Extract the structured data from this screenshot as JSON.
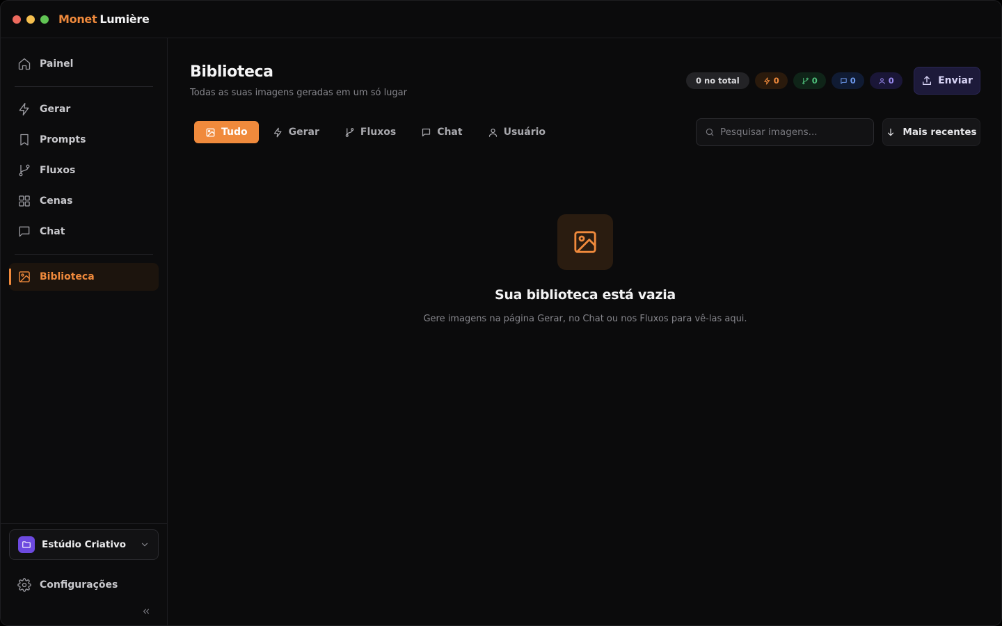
{
  "app": {
    "brand_part1": "Monet",
    "brand_part2": "Lumière",
    "accent_color": "#f08a3c"
  },
  "sidebar": {
    "items": [
      {
        "label": "Painel",
        "icon": "home-icon"
      },
      {
        "label": "Gerar",
        "icon": "bolt-icon"
      },
      {
        "label": "Prompts",
        "icon": "bookmark-icon"
      },
      {
        "label": "Fluxos",
        "icon": "git-branch-icon"
      },
      {
        "label": "Cenas",
        "icon": "grid-icon"
      },
      {
        "label": "Chat",
        "icon": "chat-icon"
      },
      {
        "label": "Biblioteca",
        "icon": "image-icon",
        "active": true
      }
    ],
    "workspace": {
      "label": "Estúdio Criativo",
      "icon": "folder-icon"
    },
    "settings_label": "Configurações"
  },
  "header": {
    "title": "Biblioteca",
    "subtitle": "Todas as suas imagens geradas em um só lugar",
    "stats": {
      "total": "0 no total",
      "gerar": "0",
      "fluxos": "0",
      "chat": "0",
      "usuario": "0"
    },
    "send_label": "Enviar"
  },
  "tabs": [
    {
      "label": "Tudo",
      "icon": "image-icon",
      "active": true
    },
    {
      "label": "Gerar",
      "icon": "bolt-icon"
    },
    {
      "label": "Fluxos",
      "icon": "git-branch-icon"
    },
    {
      "label": "Chat",
      "icon": "chat-icon"
    },
    {
      "label": "Usuário",
      "icon": "user-icon"
    }
  ],
  "search": {
    "placeholder": "Pesquisar imagens..."
  },
  "sort": {
    "label": "Mais recentes"
  },
  "empty_state": {
    "title": "Sua biblioteca está vazia",
    "message": "Gere imagens na página Gerar, no Chat ou nos Fluxos para vê-las aqui."
  }
}
